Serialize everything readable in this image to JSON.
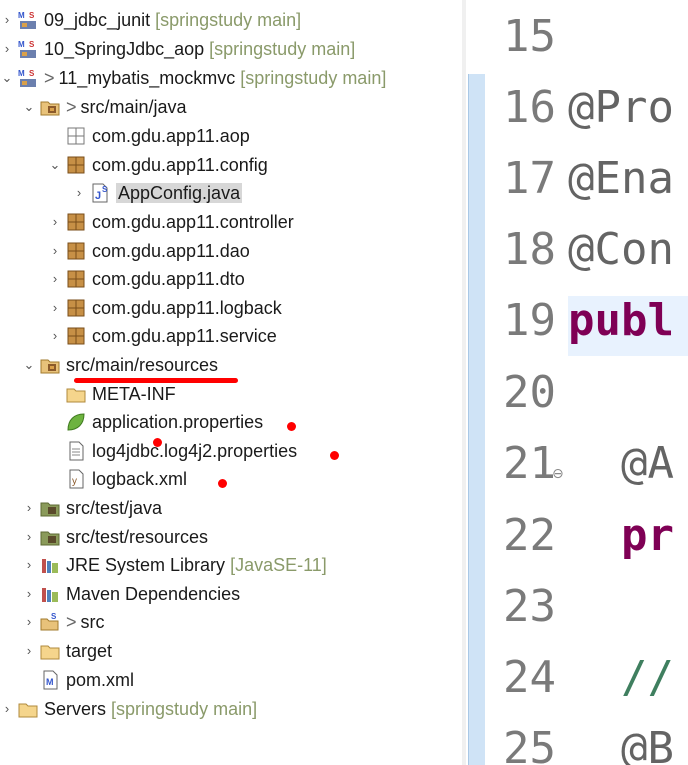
{
  "explorer": {
    "items": [
      {
        "label": "09_jdbc_junit",
        "deco": "[springstudy main]",
        "prefix": "",
        "indent": 0,
        "arrow": "›",
        "icon": "maven-project-icon",
        "sel": false
      },
      {
        "label": "10_SpringJdbc_aop",
        "deco": "[springstudy main]",
        "prefix": "",
        "indent": 0,
        "arrow": "›",
        "icon": "maven-project-icon",
        "sel": false
      },
      {
        "label": "11_mybatis_mockmvc",
        "deco": "[springstudy main]",
        "prefix": ">",
        "indent": 0,
        "arrow": "⌄",
        "icon": "maven-project-icon",
        "sel": false
      },
      {
        "label": "src/main/java",
        "deco": "",
        "prefix": ">",
        "indent": 1,
        "arrow": "⌄",
        "icon": "source-folder-icon",
        "sel": false
      },
      {
        "label": "com.gdu.app11.aop",
        "deco": "",
        "prefix": "",
        "indent": 2,
        "arrow": "",
        "icon": "empty-package-icon",
        "sel": false
      },
      {
        "label": "com.gdu.app11.config",
        "deco": "",
        "prefix": "",
        "indent": 2,
        "arrow": "⌄",
        "icon": "package-icon",
        "sel": false
      },
      {
        "label": "AppConfig.java",
        "deco": "",
        "prefix": "",
        "indent": 3,
        "arrow": "›",
        "icon": "java-file-icon",
        "sel": true
      },
      {
        "label": "com.gdu.app11.controller",
        "deco": "",
        "prefix": "",
        "indent": 2,
        "arrow": "›",
        "icon": "package-icon",
        "sel": false
      },
      {
        "label": "com.gdu.app11.dao",
        "deco": "",
        "prefix": "",
        "indent": 2,
        "arrow": "›",
        "icon": "package-icon",
        "sel": false
      },
      {
        "label": "com.gdu.app11.dto",
        "deco": "",
        "prefix": "",
        "indent": 2,
        "arrow": "›",
        "icon": "package-icon",
        "sel": false
      },
      {
        "label": "com.gdu.app11.logback",
        "deco": "",
        "prefix": "",
        "indent": 2,
        "arrow": "›",
        "icon": "package-icon",
        "sel": false
      },
      {
        "label": "com.gdu.app11.service",
        "deco": "",
        "prefix": "",
        "indent": 2,
        "arrow": "›",
        "icon": "package-icon",
        "sel": false
      },
      {
        "label": "src/main/resources",
        "deco": "",
        "prefix": "",
        "indent": 1,
        "arrow": "⌄",
        "icon": "source-folder-icon",
        "sel": false
      },
      {
        "label": "META-INF",
        "deco": "",
        "prefix": "",
        "indent": 2,
        "arrow": "",
        "icon": "folder-icon",
        "sel": false
      },
      {
        "label": "application.properties",
        "deco": "",
        "prefix": "",
        "indent": 2,
        "arrow": "",
        "icon": "spring-properties-icon",
        "sel": false
      },
      {
        "label": "log4jdbc.log4j2.properties",
        "deco": "",
        "prefix": "",
        "indent": 2,
        "arrow": "",
        "icon": "text-file-icon",
        "sel": false
      },
      {
        "label": "logback.xml",
        "deco": "",
        "prefix": "",
        "indent": 2,
        "arrow": "",
        "icon": "xml-file-icon",
        "sel": false
      },
      {
        "label": "src/test/java",
        "deco": "",
        "prefix": "",
        "indent": 1,
        "arrow": "›",
        "icon": "test-folder-icon",
        "sel": false
      },
      {
        "label": "src/test/resources",
        "deco": "",
        "prefix": "",
        "indent": 1,
        "arrow": "›",
        "icon": "test-folder-icon",
        "sel": false
      },
      {
        "label": "JRE System Library",
        "deco": "[JavaSE-11]",
        "prefix": "",
        "indent": 1,
        "arrow": "›",
        "icon": "library-icon",
        "sel": false
      },
      {
        "label": "Maven Dependencies",
        "deco": "",
        "prefix": "",
        "indent": 1,
        "arrow": "›",
        "icon": "library-icon",
        "sel": false
      },
      {
        "label": "src",
        "deco": "",
        "prefix": ">",
        "indent": 1,
        "arrow": "›",
        "icon": "src-folder-icon",
        "sel": false
      },
      {
        "label": "target",
        "deco": "",
        "prefix": "",
        "indent": 1,
        "arrow": "›",
        "icon": "folder-icon",
        "sel": false
      },
      {
        "label": "pom.xml",
        "deco": "",
        "prefix": "",
        "indent": 1,
        "arrow": "",
        "icon": "maven-pom-icon",
        "sel": false
      },
      {
        "label": "Servers",
        "deco": "[springstudy main]",
        "prefix": "",
        "indent": 0,
        "arrow": "›",
        "icon": "servers-folder-icon",
        "sel": false
      }
    ]
  },
  "editor": {
    "lines": [
      {
        "num": "15",
        "code": ""
      },
      {
        "num": "16",
        "code": "@Pro"
      },
      {
        "num": "17",
        "code": "@Ena"
      },
      {
        "num": "18",
        "code": "@Con"
      },
      {
        "num": "19",
        "code": "publ"
      },
      {
        "num": "20",
        "code": ""
      },
      {
        "num": "21",
        "code": "  @A"
      },
      {
        "num": "22",
        "code": "  pr"
      },
      {
        "num": "23",
        "code": ""
      },
      {
        "num": "24",
        "code": "  //"
      },
      {
        "num": "25",
        "code": "  @B"
      }
    ]
  },
  "colors": {
    "keyword": "#7f0055",
    "annotation_mark": "#ff0000",
    "comment": "#3f7f5f"
  }
}
